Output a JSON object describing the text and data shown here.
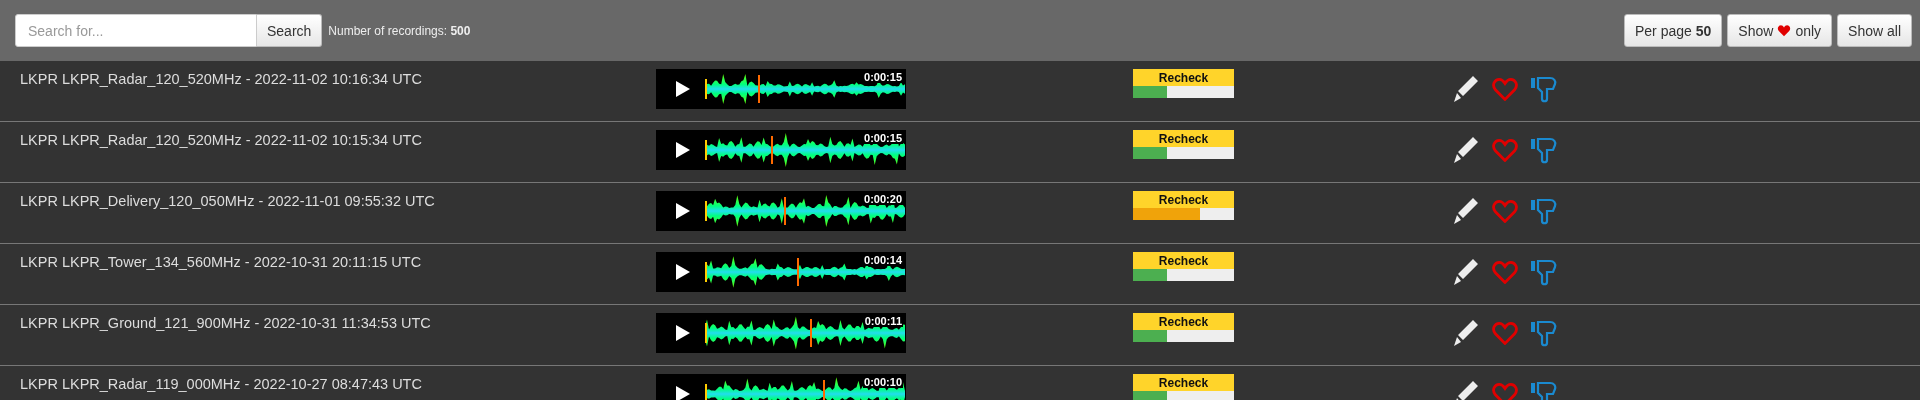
{
  "toolbar": {
    "search": {
      "placeholder": "Search for..."
    },
    "search_button": "Search",
    "count": "Number of recordings: **500**",
    "per_page_button": "Per page **50**",
    "favorites_button": {
      "before": "Show",
      "after": "only"
    },
    "show_all_button": "Show all"
  },
  "recordings": [
    {
      "title": "LKPR LKPR_Radar_120_520MHz - 2022-11-02 10:16:34 UTC",
      "duration": "0:00:15",
      "recheck": {
        "label": "Recheck",
        "level": 0.34
      }
    },
    {
      "title": "LKPR LKPR_Radar_120_520MHz - 2022-11-02 10:15:34 UTC",
      "duration": "0:00:15",
      "recheck": {
        "label": "Recheck",
        "level": 0.34
      }
    },
    {
      "title": "LKPR LKPR_Delivery_120_050MHz - 2022-11-01 09:55:32 UTC",
      "duration": "0:00:20",
      "recheck": {
        "label": "Recheck",
        "level": 0.66
      }
    },
    {
      "title": "LKPR LKPR_Tower_134_560MHz - 2022-10-31 20:11:15 UTC",
      "duration": "0:00:14",
      "recheck": {
        "label": "Recheck",
        "level": 0.34
      }
    },
    {
      "title": "LKPR LKPR_Ground_121_900MHz - 2022-10-31 11:34:53 UTC",
      "duration": "0:00:11",
      "recheck": {
        "label": "Recheck",
        "level": 0.34
      }
    },
    {
      "title": "LKPR LKPR_Radar_119_000MHz - 2022-10-27 08:47:43 UTC",
      "duration": "0:00:10",
      "recheck": {
        "label": "Recheck",
        "level": 0.34
      }
    }
  ]
}
